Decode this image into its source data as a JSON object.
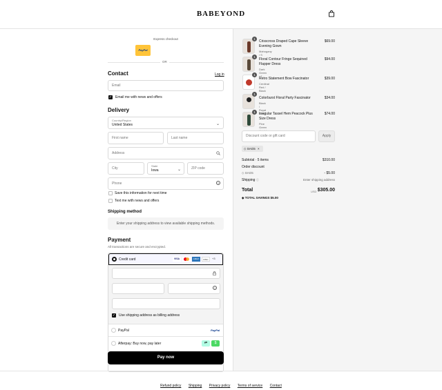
{
  "header": {
    "logo": "BABEYOND",
    "bag_icon": "shopping-bag-icon"
  },
  "express": {
    "title": "Express checkout",
    "paypal": "PayPal",
    "or": "OR"
  },
  "contact": {
    "title": "Contact",
    "login": "Log in",
    "email_placeholder": "Email",
    "news_label": "Email me with news and offers"
  },
  "delivery": {
    "title": "Delivery",
    "country_label": "Country/Region",
    "country_value": "United States",
    "first_name": "First name",
    "last_name": "Last name",
    "address": "Address",
    "city": "City",
    "state_label": "State",
    "state_value": "Iowa",
    "zip": "ZIP code",
    "phone": "Phone",
    "save_info": "Save this information for next time",
    "text_news": "Text me with news and offers"
  },
  "shipping": {
    "title": "Shipping method",
    "message": "Enter your shipping address to view available shipping methods."
  },
  "payment": {
    "title": "Payment",
    "subtitle": "All transactions are secure and encrypted.",
    "credit_card": "Credit card",
    "card_brands": [
      "VISA",
      "MC",
      "AMEX",
      "DISC",
      "+3"
    ],
    "billing_same": "Use shipping address as billing address",
    "paypal": "PayPal",
    "paypal_logo": "PayPal",
    "afterpay": "Afterpay: Buy now, pay later",
    "pay_button": "Pay now"
  },
  "cart": {
    "items": [
      {
        "name": "Crisscross Draped Cape Sleeve Evening Gown",
        "variant": "Mahogany / S",
        "price": "$69.00",
        "qty": "1"
      },
      {
        "name": "Floral Contour Fringe Sequined Flapper Dress",
        "variant": "Dark Green / 2",
        "price": "$94.00",
        "qty": "1"
      },
      {
        "name": "Retro Statement Bow Fascinator",
        "variant": "Cerdinal Red / Black",
        "price": "$39.00",
        "qty": "1"
      },
      {
        "name": "Colorburst Floral Party Fascinator",
        "variant": "Black / Royal Gold",
        "price": "$34.00",
        "qty": "1"
      },
      {
        "name": "Irregular Tassel Hem Peacock Plus Size Dress",
        "variant": "Pine Green / Light Gold / XL",
        "price": "$74.00",
        "qty": "1"
      }
    ],
    "discount_placeholder": "Discount code or gift card",
    "apply": "Apply",
    "tag": "SAG5",
    "subtotal_label": "Subtotal · 5 items",
    "subtotal_value": "$310.00",
    "order_discount": "Order discount",
    "discount_code": "SAG5",
    "discount_value": "- $5.00",
    "shipping_label": "Shipping",
    "shipping_value": "Enter shipping address",
    "total_label": "Total",
    "currency": "USD",
    "total_value": "$305.00",
    "savings_label": "TOTAL SAVINGS",
    "savings_value": "$5.00"
  },
  "footer": {
    "links": [
      "Refund policy",
      "Shipping",
      "Privacy policy",
      "Terms of service",
      "Contact"
    ]
  }
}
